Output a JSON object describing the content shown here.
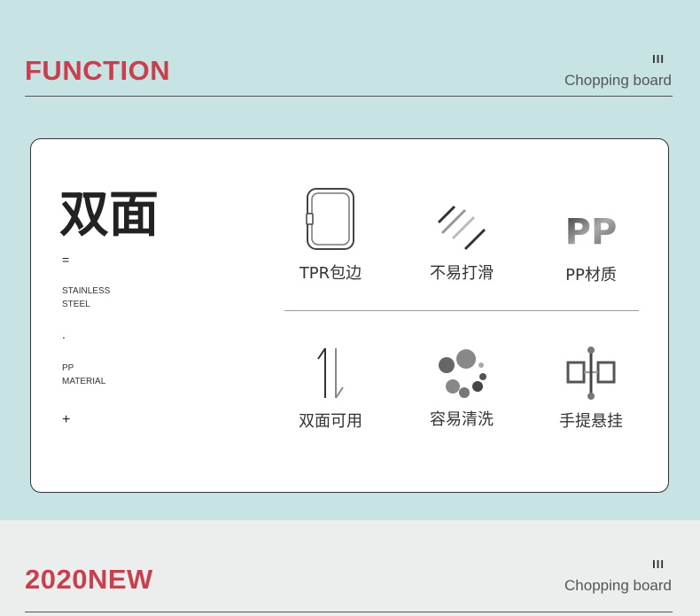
{
  "section1": {
    "heading": "FUNCTION",
    "roman": "III",
    "subtitle": "Chopping board"
  },
  "card": {
    "title": "双面",
    "equals": "=",
    "material1": [
      "STAINLESS",
      "STEEL"
    ],
    "dot": ".",
    "material2": [
      "PP",
      "MATERIAL"
    ],
    "plus": "+",
    "features": [
      {
        "label": "TPR包边",
        "icon": "tablet-edge-icon"
      },
      {
        "label": "不易打滑",
        "icon": "slip-lines-icon"
      },
      {
        "label": "PP材质",
        "icon": "pp-text-icon",
        "icon_text": "PP"
      },
      {
        "label": "双面可用",
        "icon": "flip-arrows-icon"
      },
      {
        "label": "容易清洗",
        "icon": "bubbles-icon"
      },
      {
        "label": "手提悬挂",
        "icon": "hanger-icon"
      }
    ]
  },
  "section2": {
    "heading": "2020NEW",
    "roman": "III",
    "subtitle": "Chopping board"
  }
}
